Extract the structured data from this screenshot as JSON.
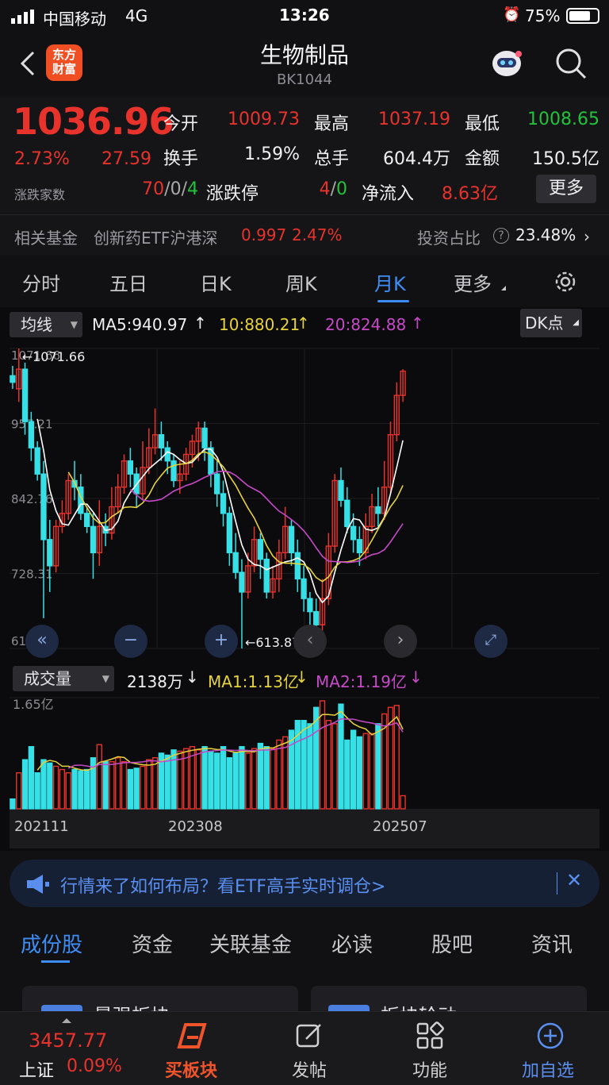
{
  "status": {
    "carrier": "中国移动",
    "network": "4G",
    "time": "13:26",
    "battery": "75%"
  },
  "header": {
    "title": "生物制品",
    "code": "BK1044",
    "logo_line1": "东方",
    "logo_line2": "财富"
  },
  "quote": {
    "price": "1036.96",
    "change_pct": "2.73%",
    "change": "27.59",
    "open_label": "今开",
    "open": "1009.73",
    "high_label": "最高",
    "high": "1037.19",
    "low_label": "最低",
    "low": "1008.65",
    "turnover_label": "换手",
    "turnover": "1.59%",
    "volume_label": "总手",
    "volume": "604.4万",
    "amount_label": "金额",
    "amount": "150.5亿",
    "updown_label": "涨跌家数",
    "up": "70",
    "flat": "0",
    "down": "4",
    "limit_label": "涨跌停",
    "limit_up": "4",
    "limit_down": "0",
    "netflow_label": "净流入",
    "netflow": "8.63亿",
    "more_button": "更多"
  },
  "fund": {
    "label": "相关基金",
    "name": "创新药ETF沪港深",
    "price": "0.997",
    "pct": "2.47%",
    "ratio_label": "投资占比",
    "ratio": "23.48%"
  },
  "period_tabs": [
    "分时",
    "五日",
    "日K",
    "周K",
    "月K",
    "更多"
  ],
  "active_tab": "月K",
  "chart_controls": {
    "ma_select": "均线",
    "ma5": "MA5:940.97",
    "ma10": "10:880.21",
    "ma20": "20:824.88",
    "dk_button": "DK点",
    "vol_select": "成交量",
    "vol_value": "2138万",
    "vol_ma1": "MA1:1.13亿",
    "vol_ma2": "MA2:1.19亿"
  },
  "colors": {
    "up": "#e8332c",
    "down": "#35e0e6",
    "ma5": "#ffffff",
    "ma10": "#e6d23a",
    "ma20": "#c64ac8",
    "accent": "#3d8df5"
  },
  "chart_data": {
    "type": "candlestick",
    "y_ticks": [
      "1071.66",
      "957.21",
      "842.76",
      "728.31",
      "613.87"
    ],
    "ylim": [
      613.87,
      1071.66
    ],
    "max_label": "1071.66",
    "min_label": "613.87",
    "vol_max_label": "1.65亿",
    "x_labels": [
      "202111",
      "202308",
      "202507"
    ],
    "candles": [
      [
        1030,
        1020,
        1045,
        1010
      ],
      [
        1010,
        1040,
        1071.66,
        990
      ],
      [
        1040,
        960,
        1050,
        940
      ],
      [
        960,
        920,
        975,
        900
      ],
      [
        920,
        880,
        930,
        870
      ],
      [
        880,
        780,
        900,
        660
      ],
      [
        780,
        740,
        810,
        700
      ],
      [
        740,
        800,
        810,
        730
      ],
      [
        800,
        820,
        840,
        790
      ],
      [
        820,
        870,
        880,
        810
      ],
      [
        870,
        860,
        900,
        840
      ],
      [
        860,
        820,
        880,
        810
      ],
      [
        820,
        800,
        830,
        790
      ],
      [
        800,
        760,
        820,
        720
      ],
      [
        760,
        800,
        840,
        740
      ],
      [
        800,
        790,
        820,
        770
      ],
      [
        790,
        830,
        860,
        780
      ],
      [
        830,
        860,
        880,
        820
      ],
      [
        860,
        900,
        910,
        850
      ],
      [
        900,
        880,
        920,
        860
      ],
      [
        880,
        850,
        890,
        830
      ],
      [
        850,
        890,
        930,
        840
      ],
      [
        890,
        920,
        950,
        880
      ],
      [
        920,
        940,
        980,
        910
      ],
      [
        940,
        920,
        960,
        900
      ],
      [
        920,
        900,
        930,
        880
      ],
      [
        900,
        870,
        910,
        860
      ],
      [
        870,
        880,
        900,
        850
      ],
      [
        880,
        910,
        920,
        870
      ],
      [
        910,
        930,
        940,
        890
      ],
      [
        930,
        950,
        960,
        900
      ],
      [
        950,
        920,
        960,
        900
      ],
      [
        920,
        880,
        930,
        860
      ],
      [
        880,
        850,
        900,
        830
      ],
      [
        850,
        820,
        870,
        800
      ],
      [
        820,
        760,
        830,
        740
      ],
      [
        760,
        730,
        790,
        720
      ],
      [
        730,
        700,
        750,
        613.87
      ],
      [
        700,
        740,
        760,
        690
      ],
      [
        740,
        780,
        800,
        730
      ],
      [
        780,
        750,
        790,
        720
      ],
      [
        750,
        700,
        760,
        690
      ],
      [
        700,
        720,
        740,
        690
      ],
      [
        720,
        760,
        780,
        700
      ],
      [
        760,
        800,
        830,
        750
      ],
      [
        800,
        760,
        810,
        740
      ],
      [
        760,
        720,
        780,
        700
      ],
      [
        720,
        690,
        740,
        670
      ],
      [
        690,
        670,
        700,
        650
      ],
      [
        670,
        650,
        690,
        630
      ],
      [
        650,
        690,
        720,
        640
      ],
      [
        690,
        770,
        790,
        680
      ],
      [
        770,
        870,
        880,
        760
      ],
      [
        870,
        840,
        890,
        830
      ],
      [
        840,
        800,
        860,
        790
      ],
      [
        800,
        780,
        820,
        760
      ],
      [
        780,
        760,
        800,
        740
      ],
      [
        760,
        800,
        820,
        750
      ],
      [
        800,
        830,
        850,
        790
      ],
      [
        830,
        820,
        860,
        800
      ],
      [
        820,
        860,
        900,
        810
      ],
      [
        860,
        940,
        960,
        850
      ],
      [
        940,
        1000,
        1020,
        930
      ],
      [
        1000,
        1036.96,
        1040,
        990
      ]
    ],
    "volumes": [
      0.15,
      0.55,
      0.75,
      0.95,
      0.55,
      0.75,
      0.7,
      0.65,
      0.6,
      0.55,
      0.6,
      0.58,
      0.6,
      0.78,
      0.98,
      0.72,
      0.72,
      0.78,
      0.72,
      0.6,
      0.62,
      0.65,
      0.75,
      0.78,
      0.85,
      0.82,
      0.9,
      0.88,
      0.92,
      0.95,
      0.9,
      0.95,
      0.88,
      0.85,
      0.95,
      0.78,
      0.85,
      0.95,
      0.85,
      0.92,
      1.0,
      0.95,
      0.92,
      1.05,
      1.1,
      1.2,
      1.35,
      1.35,
      1.3,
      1.55,
      1.65,
      1.35,
      1.3,
      1.6,
      1.05,
      1.2,
      1.1,
      1.15,
      1.15,
      1.3,
      1.45,
      1.55,
      1.58,
      0.2
    ]
  },
  "banner": {
    "text": "行情来了如何布局？看ETF高手实时调仓>"
  },
  "section_tabs": [
    "成份股",
    "资金",
    "关联基金",
    "必读",
    "股吧",
    "资讯"
  ],
  "section_active": "成份股",
  "cards": [
    "最强板块",
    "板块轮动"
  ],
  "bottom": {
    "index_value": "3457.77",
    "index_name": "上证",
    "index_pct": "0.09%",
    "buy_label": "买板块",
    "post_label": "发帖",
    "func_label": "功能",
    "add_label": "加自选"
  }
}
